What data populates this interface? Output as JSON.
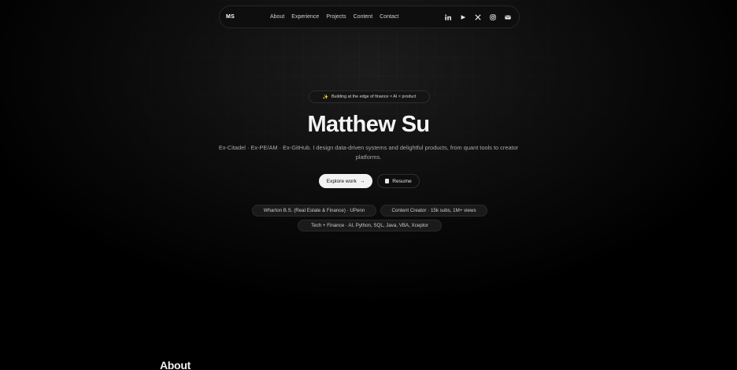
{
  "nav": {
    "brand": "MS",
    "links": [
      "About",
      "Experience",
      "Projects",
      "Content",
      "Contact"
    ],
    "icons": [
      "linkedin-icon",
      "youtube-icon",
      "x-icon",
      "instagram-icon",
      "email-icon"
    ]
  },
  "hero": {
    "badge_icon": "✨",
    "badge": "Building at the edge of finance × AI × product",
    "name": "Matthew Su",
    "tagline": "Ex-Citadel · Ex-PE/AM · Ex-GitHub. I design data-driven systems and delightful products, from quant tools to creator platforms.",
    "cta_primary": "Explore work",
    "cta_primary_arrow": "→",
    "cta_secondary": "Resume",
    "chips": [
      "Wharton B.S. (Real Estate & Finance) · UPenn",
      "Content Creator · 15k subs, 1M+ views",
      "Tech + Finance · AI, Python, SQL, Java, VBA, Xceptor"
    ]
  },
  "about": {
    "heading": "About"
  },
  "colors": {
    "background": "#000000",
    "accent": "#f2f2f2",
    "badge_spark": "#e6c36a"
  }
}
